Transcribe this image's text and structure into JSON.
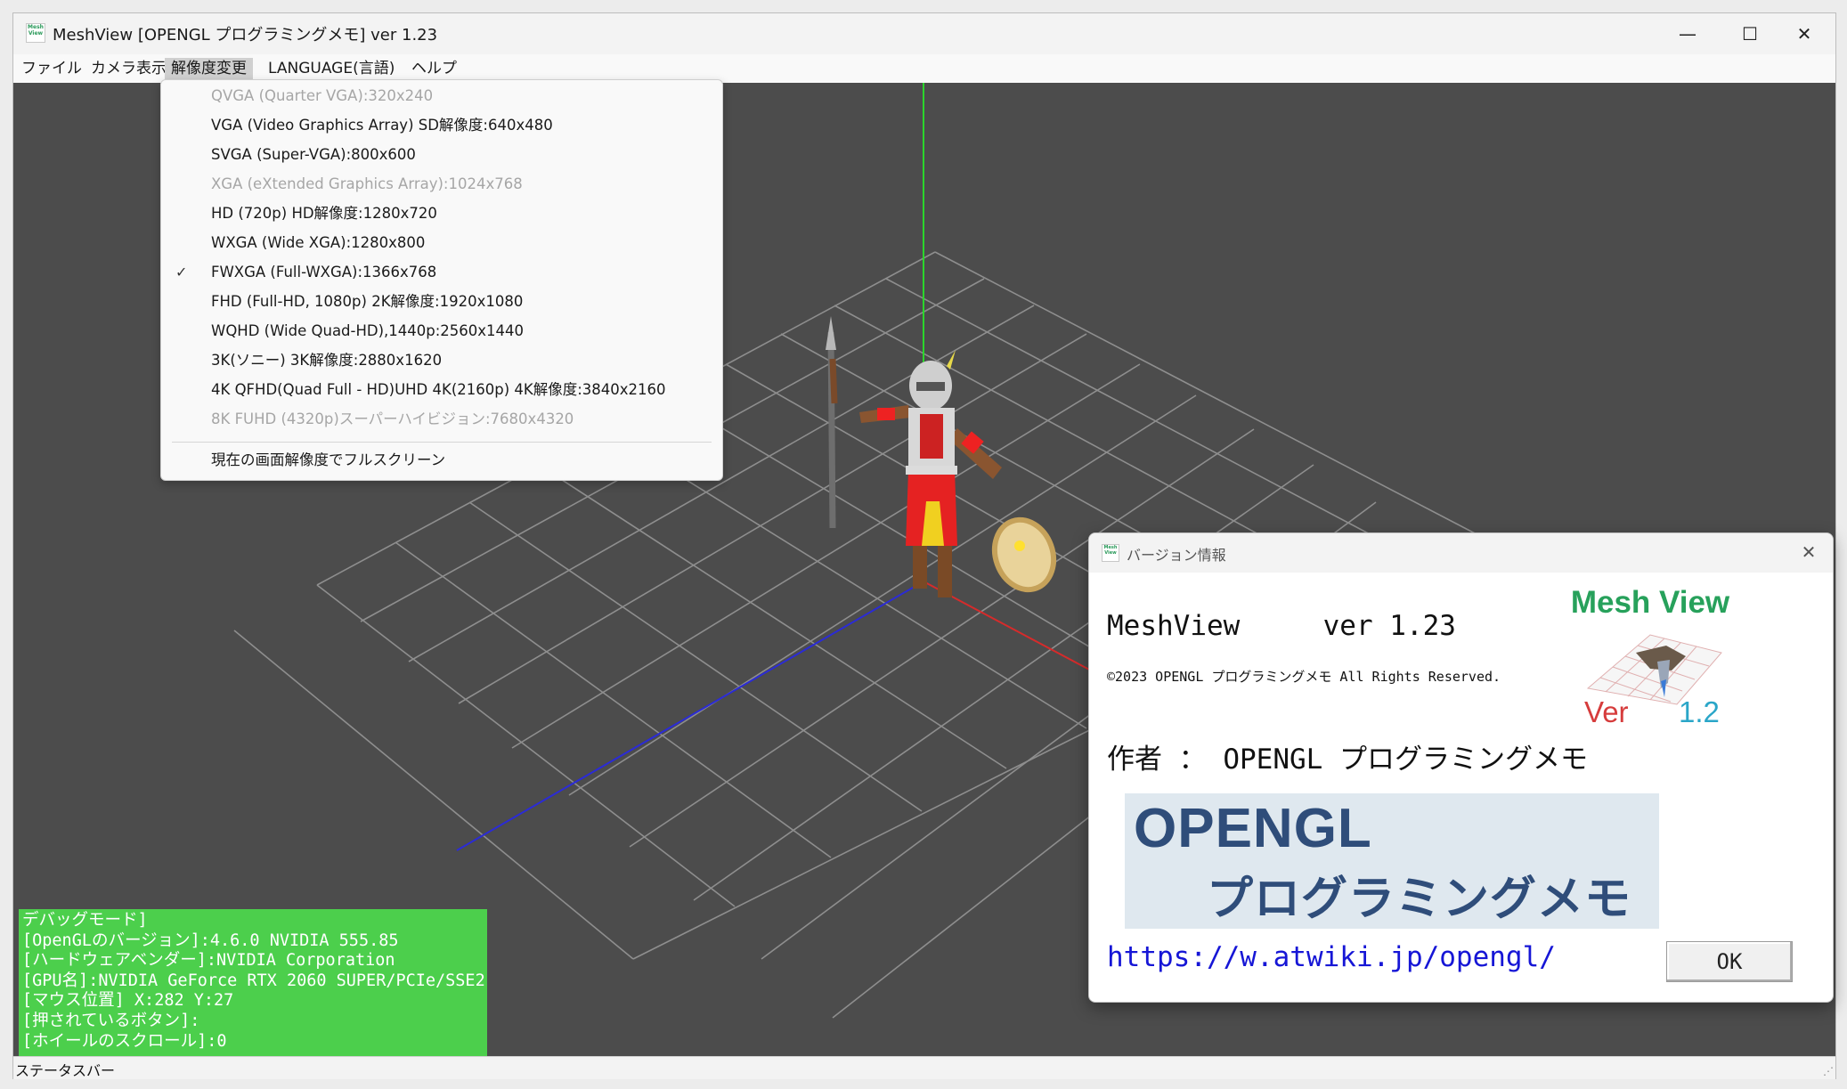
{
  "window": {
    "title": "MeshView [OPENGL プログラミングメモ] ver 1.23",
    "icon": "meshview-app-icon",
    "icon_text": "Mesh View",
    "controls": {
      "minimize": "—",
      "maximize": "☐",
      "close": "✕"
    }
  },
  "menubar": {
    "items": [
      {
        "label": "ファイル"
      },
      {
        "label": "カメラ表示"
      },
      {
        "label": "解像度変更"
      },
      {
        "label": "LANGUAGE(言語)"
      },
      {
        "label": "ヘルプ"
      }
    ]
  },
  "resolution_menu": {
    "items": [
      {
        "label": "QVGA (Quarter VGA):320x240",
        "enabled": false,
        "checked": false
      },
      {
        "label": "VGA (Video Graphics Array) SD解像度:640x480",
        "enabled": true,
        "checked": false
      },
      {
        "label": "SVGA (Super-VGA):800x600",
        "enabled": true,
        "checked": false
      },
      {
        "label": "XGA (eXtended Graphics Array):1024x768",
        "enabled": false,
        "checked": false
      },
      {
        "label": "HD (720p) HD解像度:1280x720",
        "enabled": true,
        "checked": false
      },
      {
        "label": "WXGA (Wide XGA):1280x800",
        "enabled": true,
        "checked": false
      },
      {
        "label": "FWXGA (Full-WXGA):1366x768",
        "enabled": true,
        "checked": true
      },
      {
        "label": "FHD (Full-HD, 1080p) 2K解像度:1920x1080",
        "enabled": true,
        "checked": false
      },
      {
        "label": "WQHD (Wide Quad-HD),1440p:2560x1440",
        "enabled": true,
        "checked": false
      },
      {
        "label": "3K(ソニー) 3K解像度:2880x1620",
        "enabled": true,
        "checked": false
      },
      {
        "label": "4K QFHD(Quad Full - HD)UHD 4K(2160p) 4K解像度:3840x2160",
        "enabled": true,
        "checked": false
      },
      {
        "label": "8K FUHD (4320p)スーパーハイビジョン:7680x4320",
        "enabled": false,
        "checked": false
      }
    ],
    "check_glyph": "✓",
    "fullscreen_label": "現在の画面解像度でフルスクリーン"
  },
  "debug_overlay": {
    "lines": [
      "デバッグモード]",
      "[OpenGLのバージョン]:4.6.0 NVIDIA 555.85",
      "[ハードウェアベンダー]:NVIDIA Corporation",
      "[GPU名]:NVIDIA GeForce RTX 2060 SUPER/PCIe/SSE2",
      "[マウス位置] X:282 Y:27",
      "[押されているボタン]:",
      "[ホイールのスクロール]:0"
    ],
    "background": "#4ccf4c"
  },
  "statusbar": {
    "text": "ステータスバー"
  },
  "about_dialog": {
    "title": "バージョン情報",
    "app_name_line": "MeshView     ver 1.23",
    "copyright": "©2023 OPENGL プログラミングメモ All Rights Reserved.",
    "author_line": "作者 ： OPENGL プログラミングメモ",
    "logo": {
      "title": "Mesh View",
      "ver_label": "Ver",
      "ver_num": "1.2"
    },
    "banner": {
      "line1": "OPENGL",
      "line2": "プログラミングメモ"
    },
    "url": "https://w.atwiki.jp/opengl/",
    "ok_label": "OK",
    "close_glyph": "✕"
  },
  "scene": {
    "background": "#4c4c4c",
    "grid_color": "#9a9a9a",
    "axis_colors": {
      "x": "#d62b2b",
      "y": "#2bd62b",
      "z": "#2b2bd6"
    }
  }
}
